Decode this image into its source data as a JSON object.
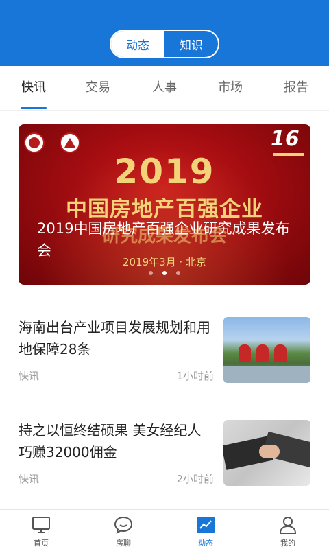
{
  "header": {
    "segments": [
      {
        "label": "动态",
        "active": true
      },
      {
        "label": "知识",
        "active": false
      }
    ]
  },
  "tabs": [
    {
      "label": "快讯",
      "active": true
    },
    {
      "label": "交易",
      "active": false
    },
    {
      "label": "人事",
      "active": false
    },
    {
      "label": "市场",
      "active": false
    },
    {
      "label": "报告",
      "active": false
    }
  ],
  "banner": {
    "poster_year": "2019",
    "poster_headline": "中国房地产百强企业",
    "poster_sub": "研究成果发布会",
    "poster_date": "2019年3月 · 北京",
    "badge_number": "16",
    "title": "2019中国房地产百强企业研究成果发布会",
    "slide_count": 3,
    "active_slide": 2
  },
  "news": [
    {
      "title": "海南出台产业项目发展规划和用地保障28条",
      "category": "快讯",
      "time": "1小时前",
      "thumb_icon": "building-photo"
    },
    {
      "title": "持之以恒终结硕果 美女经纪人巧赚32000佣金",
      "category": "快讯",
      "time": "2小时前",
      "thumb_icon": "handshake-photo"
    }
  ],
  "bottom_nav": [
    {
      "label": "首页",
      "icon": "monitor-icon",
      "active": false
    },
    {
      "label": "房聊",
      "icon": "chat-bubble-icon",
      "active": false
    },
    {
      "label": "动态",
      "icon": "trend-chart-icon",
      "active": true
    },
    {
      "label": "我的",
      "icon": "user-icon",
      "active": false
    }
  ],
  "colors": {
    "primary": "#1976D9",
    "poster_gold": "#f3d37a",
    "poster_red": "#a10c10"
  }
}
